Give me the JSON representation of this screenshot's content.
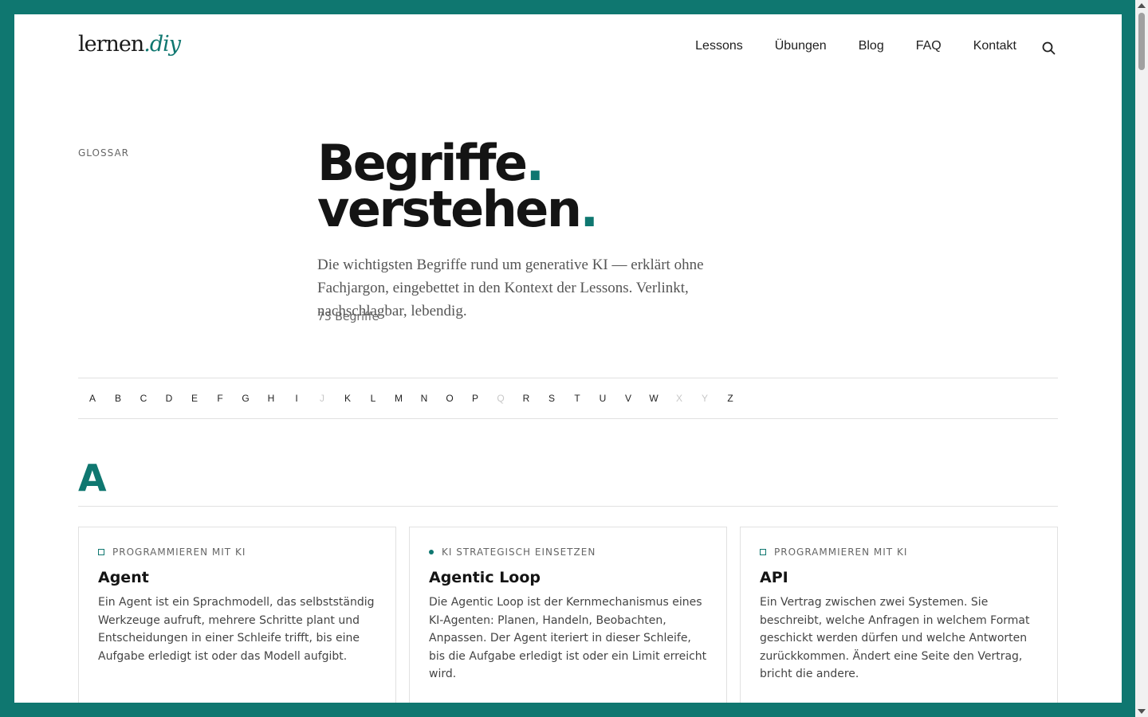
{
  "brand": {
    "logo_main": "lernen",
    "logo_accent": ".diy",
    "accent_color": "#0f7770"
  },
  "nav": {
    "items": [
      "Lessons",
      "Übungen",
      "Blog",
      "FAQ",
      "Kontakt"
    ],
    "search_icon": "search-icon"
  },
  "hero": {
    "eyebrow": "GLOSSAR",
    "title_line1": "Begriffe",
    "title_line2": "verstehen",
    "title_dot": ".",
    "lead": "Die wichtigsten Begriffe rund um generative KI — erklärt ohne Fachjargon, eingebettet in den Kontext der Lessons. Verlinkt, nachschlagbar, lebendig.",
    "count": "73 Begriffe"
  },
  "alphabet": [
    {
      "l": "A",
      "on": true
    },
    {
      "l": "B",
      "on": true
    },
    {
      "l": "C",
      "on": true
    },
    {
      "l": "D",
      "on": true
    },
    {
      "l": "E",
      "on": true
    },
    {
      "l": "F",
      "on": true
    },
    {
      "l": "G",
      "on": true
    },
    {
      "l": "H",
      "on": true
    },
    {
      "l": "I",
      "on": true
    },
    {
      "l": "J",
      "on": false
    },
    {
      "l": "K",
      "on": true
    },
    {
      "l": "L",
      "on": true
    },
    {
      "l": "M",
      "on": true
    },
    {
      "l": "N",
      "on": true
    },
    {
      "l": "O",
      "on": true
    },
    {
      "l": "P",
      "on": true
    },
    {
      "l": "Q",
      "on": false
    },
    {
      "l": "R",
      "on": true
    },
    {
      "l": "S",
      "on": true
    },
    {
      "l": "T",
      "on": true
    },
    {
      "l": "U",
      "on": true
    },
    {
      "l": "V",
      "on": true
    },
    {
      "l": "W",
      "on": true
    },
    {
      "l": "X",
      "on": false
    },
    {
      "l": "Y",
      "on": false
    },
    {
      "l": "Z",
      "on": true
    }
  ],
  "section": {
    "letter": "A"
  },
  "cards": [
    {
      "category": "PROGRAMMIEREN MIT KI",
      "category_icon": "square-outline-icon",
      "title": "Agent",
      "text": "Ein Agent ist ein Sprachmodell, das selbstständig Werkzeuge aufruft, mehrere Schritte plant und Entscheidungen in einer Schleife trifft, bis eine Aufgabe erledigt ist oder das Modell aufgibt."
    },
    {
      "category": "KI STRATEGISCH EINSETZEN",
      "category_icon": "dot-icon",
      "title": "Agentic Loop",
      "text": "Die Agentic Loop ist der Kernmechanismus eines KI-Agenten: Planen, Handeln, Beobachten, Anpassen. Der Agent iteriert in dieser Schleife, bis die Aufgabe erledigt ist oder ein Limit erreicht wird."
    },
    {
      "category": "PROGRAMMIEREN MIT KI",
      "category_icon": "square-outline-icon",
      "title": "API",
      "text": "Ein Vertrag zwischen zwei Systemen. Sie beschreibt, welche Anfragen in welchem Format geschickt werden dürfen und welche Antworten zurückkommen. Ändert eine Seite den Vertrag, bricht die andere."
    }
  ]
}
